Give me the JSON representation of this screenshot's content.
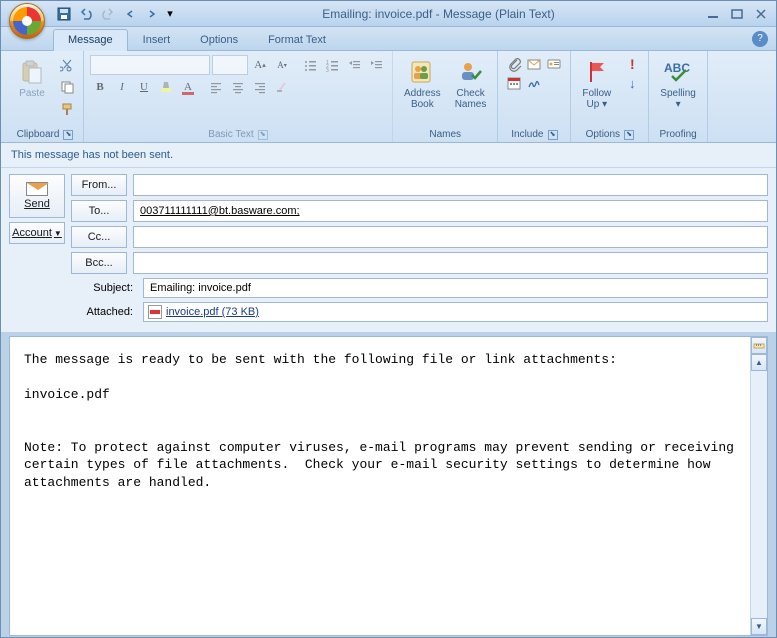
{
  "title": "Emailing: invoice.pdf - Message (Plain Text)",
  "tabs": {
    "message": "Message",
    "insert": "Insert",
    "options": "Options",
    "format": "Format Text"
  },
  "ribbon": {
    "clipboard": {
      "paste": "Paste",
      "label": "Clipboard"
    },
    "basic_text": {
      "label": "Basic Text"
    },
    "names": {
      "address": "Address\nBook",
      "check": "Check\nNames",
      "label": "Names"
    },
    "include": {
      "label": "Include"
    },
    "options": {
      "follow": "Follow\nUp ▾",
      "label": "Options"
    },
    "proofing": {
      "spelling": "Spelling\n▾",
      "label": "Proofing"
    }
  },
  "infobar": "This message has not been sent.",
  "compose": {
    "send": "Send",
    "account": "Account",
    "from": "From...",
    "to": "To...",
    "to_value": "003711111111@bt.basware.com;",
    "cc": "Cc...",
    "bcc": "Bcc...",
    "subject_lbl": "Subject:",
    "subject_value": "Emailing: invoice.pdf",
    "attached_lbl": "Attached:",
    "attachment_name": "invoice.pdf (73 KB)"
  },
  "body": "The message is ready to be sent with the following file or link attachments:\n\ninvoice.pdf\n\n\nNote: To protect against computer viruses, e-mail programs may prevent sending or receiving certain types of file attachments.  Check your e-mail security settings to determine how attachments are handled."
}
